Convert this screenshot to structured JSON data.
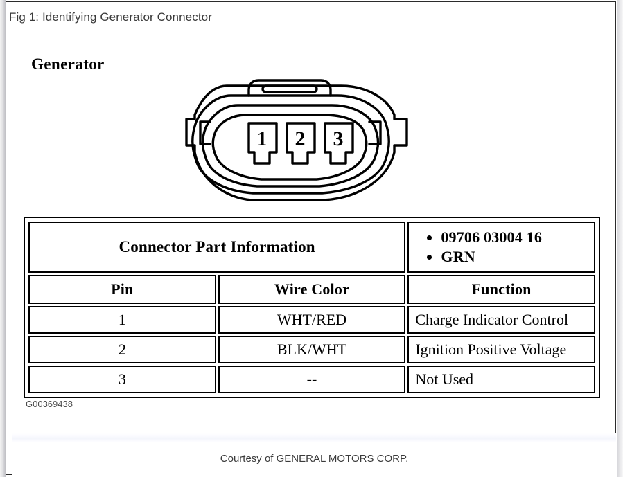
{
  "figure": {
    "title": "Fig 1: Identifying Generator Connector",
    "heading": "Generator",
    "drawing_id": "G00369438"
  },
  "connector": {
    "name": "generator-connector-diagram",
    "pin_labels": [
      "1",
      "2",
      "3"
    ],
    "line_color": "#000000",
    "fill_color": "#ffffff"
  },
  "table": {
    "part_info_label": "Connector Part Information",
    "part_info_values": [
      "09706 03004 16",
      "GRN"
    ],
    "headers": {
      "pin": "Pin",
      "wire_color": "Wire Color",
      "function": "Function"
    },
    "rows": [
      {
        "pin": "1",
        "wire_color": "WHT/RED",
        "function": "Charge Indicator Control"
      },
      {
        "pin": "2",
        "wire_color": "BLK/WHT",
        "function": "Ignition Positive Voltage"
      },
      {
        "pin": "3",
        "wire_color": "--",
        "function": "Not Used"
      }
    ]
  },
  "footer": {
    "courtesy": "Courtesy of GENERAL MOTORS CORP."
  }
}
